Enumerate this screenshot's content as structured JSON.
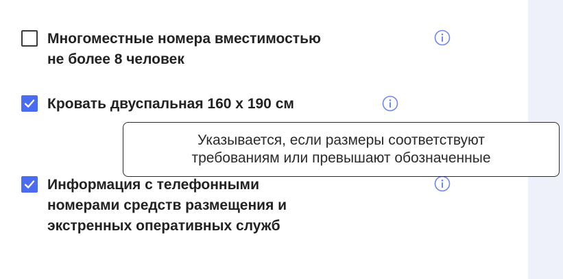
{
  "options": [
    {
      "label_line1": "Многоместные номера вместимостью",
      "label_line2": "не более 8 человек",
      "checked": false,
      "icon": "info-icon"
    },
    {
      "label_line1": "Кровать двуспальная 160 х 190 см",
      "checked": true,
      "icon": "info-icon"
    },
    {
      "label_line1": "Информация с телефонными",
      "label_line2": "номерами средств размещения и",
      "label_line3": "экстренных оперативных служб",
      "checked": true,
      "icon": "info-icon"
    }
  ],
  "tooltip": {
    "line1": "Указывается, если размеры соответствуют",
    "line2": "требованиям или превышают обозначенные"
  },
  "colors": {
    "checkbox_checked": "#4a6cf0",
    "info_icon": "#6f86ee",
    "side_panel": "#eef0fa"
  }
}
